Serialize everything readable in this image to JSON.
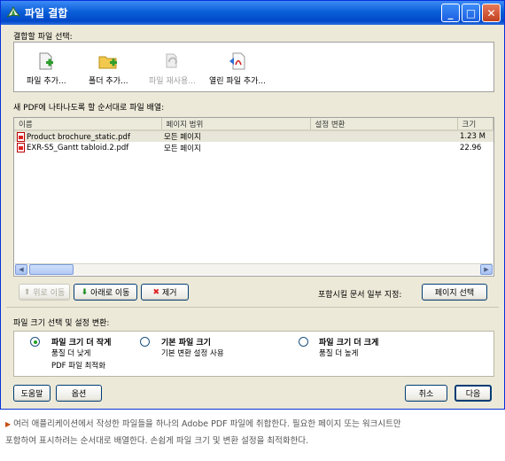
{
  "window": {
    "title": "파일 결합"
  },
  "select_section": {
    "label": "결합할 파일 선택:",
    "buttons": [
      {
        "label": "파일 추가...",
        "icon": "add-file-icon",
        "enabled": true
      },
      {
        "label": "폴더 추가...",
        "icon": "add-folder-icon",
        "enabled": true
      },
      {
        "label": "파일 재사용...",
        "icon": "reuse-files-icon",
        "enabled": false
      },
      {
        "label": "열린 파일 추가...",
        "icon": "add-open-files-icon",
        "enabled": true
      }
    ]
  },
  "list_section": {
    "label": "새 PDF에 나타나도록 할 순서대로 파일 배열:",
    "columns": [
      "이름",
      "페이지 범위",
      "설정 변환",
      "크기"
    ],
    "rows": [
      {
        "name": "Product brochure_static.pdf",
        "range": "모든 페이지",
        "conversion": "",
        "size": "1.23 M"
      },
      {
        "name": "EXR-S5_Gantt tabloid.2.pdf",
        "range": "모든 페이지",
        "conversion": "",
        "size": "22.96"
      }
    ],
    "move_up_label": "위로 이동",
    "move_down_label": "아래로 이동",
    "remove_label": "제거",
    "pages_hint": "포함시킬 문서 일부 지정:",
    "choose_pages_label": "페이지 선택"
  },
  "size_section": {
    "label": "파일 크기 선택 및 설정 변환:",
    "options": [
      {
        "title": "파일 크기 더 작게",
        "desc1": "품질 더 낮게",
        "desc2": "PDF 파일 최적화",
        "checked": true
      },
      {
        "title": "기본 파일 크기",
        "desc1": "기본 변환 설정 사용",
        "desc2": "",
        "checked": false
      },
      {
        "title": "파일 크기 더 크게",
        "desc1": "품질 더 높게",
        "desc2": "",
        "checked": false
      }
    ]
  },
  "footer": {
    "help_label": "도움말",
    "options_label": "옵션",
    "cancel_label": "취소",
    "next_label": "다음"
  },
  "caption": {
    "line1": "여러 애플리케이션에서 작성한 파일들을 하나의 Adobe PDF 파일에 취합한다. 필요한 페이지 또는 워크시트만",
    "line2": "포함하여 표시하려는 순서대로 배열한다. 손쉽게 파일 크기 및 변환 설정을 최적화한다."
  }
}
